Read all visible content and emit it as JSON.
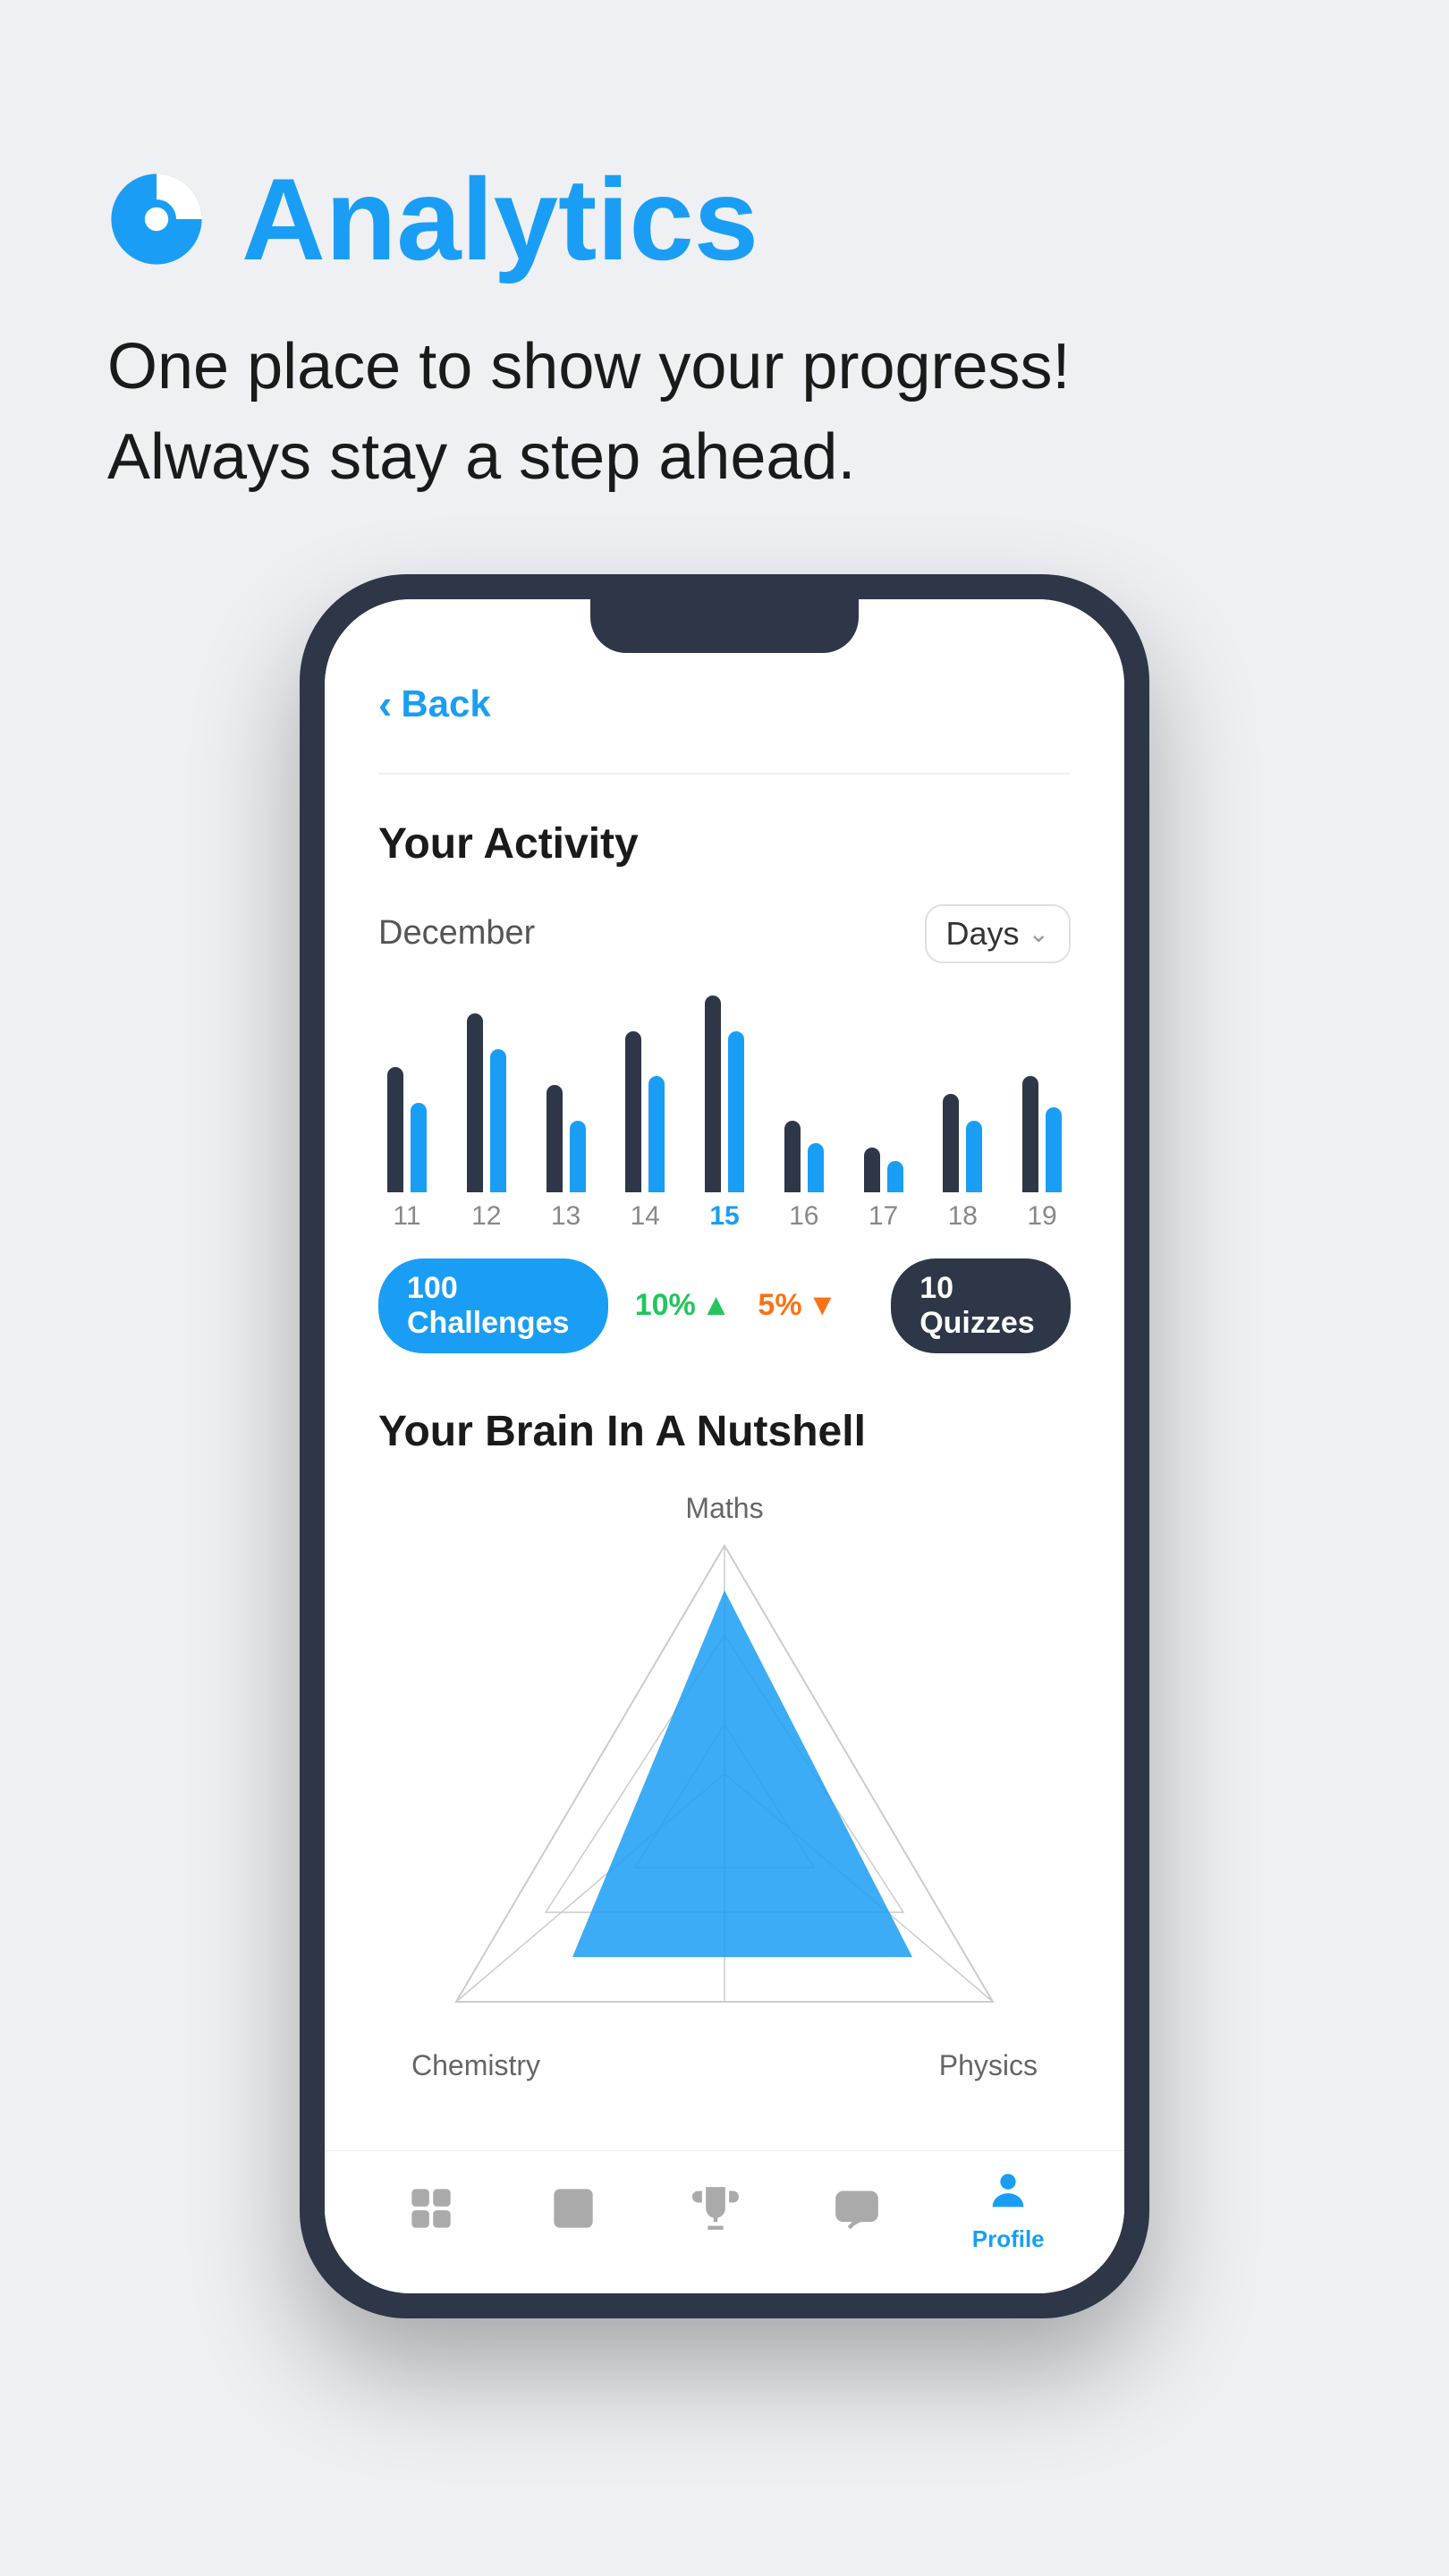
{
  "page": {
    "background_color": "#eef0f3",
    "title": "Analytics",
    "subtitle_line1": "One place to show your progress!",
    "subtitle_line2": "Always stay a step ahead."
  },
  "phone": {
    "back_label": "Back",
    "screen": {
      "activity": {
        "title": "Your Activity",
        "month": "December",
        "filter": "Days",
        "bars": [
          {
            "day": "11",
            "height1": 140,
            "height2": 100,
            "active": false
          },
          {
            "day": "12",
            "height1": 200,
            "height2": 160,
            "active": false
          },
          {
            "day": "13",
            "height1": 120,
            "height2": 80,
            "active": false
          },
          {
            "day": "14",
            "height1": 180,
            "height2": 130,
            "active": false
          },
          {
            "day": "15",
            "height1": 220,
            "height2": 180,
            "active": true
          },
          {
            "day": "16",
            "height1": 100,
            "height2": 70,
            "active": false
          },
          {
            "day": "17",
            "height1": 60,
            "height2": 40,
            "active": false
          },
          {
            "day": "18",
            "height1": 110,
            "height2": 90,
            "active": false
          },
          {
            "day": "19",
            "height1": 130,
            "height2": 100,
            "active": false
          }
        ],
        "stats": {
          "challenges_count": "100",
          "challenges_label": "Challenges",
          "change1_value": "10%",
          "change1_direction": "up",
          "change2_value": "5%",
          "change2_direction": "down",
          "quizzes_count": "10",
          "quizzes_label": "Quizzes"
        }
      },
      "brain": {
        "title": "Your Brain In A Nutshell",
        "labels": {
          "top": "Maths",
          "bottom_left": "Chemistry",
          "bottom_right": "Physics"
        }
      }
    }
  },
  "nav": {
    "items": [
      {
        "id": "home",
        "label": "",
        "active": false
      },
      {
        "id": "lessons",
        "label": "",
        "active": false
      },
      {
        "id": "trophy",
        "label": "",
        "active": false
      },
      {
        "id": "chat",
        "label": "",
        "active": false
      },
      {
        "id": "profile",
        "label": "Profile",
        "active": true
      }
    ]
  }
}
